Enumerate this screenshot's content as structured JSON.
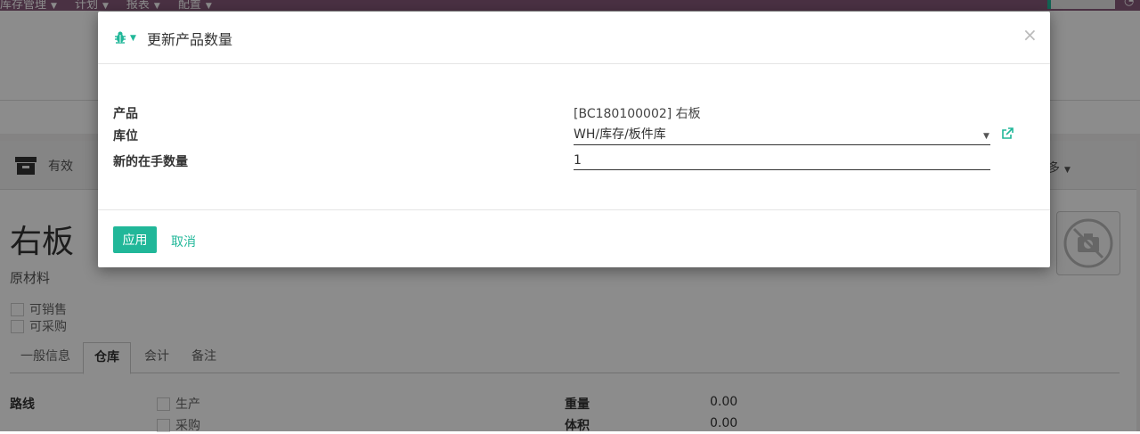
{
  "topmenu": {
    "items": [
      "库存管理",
      "计划",
      "报表",
      "配置"
    ]
  },
  "statusbar": {
    "archive_label": "有效",
    "more_label": "多"
  },
  "product": {
    "title": "右板",
    "category": "原材料",
    "can_be_sold": "可销售",
    "can_be_purchased": "可采购"
  },
  "tabs": [
    "一般信息",
    "仓库",
    "会计",
    "备注"
  ],
  "inventory": {
    "routes_label": "路线",
    "route_manufacture": "生产",
    "route_buy": "采购",
    "weight_label": "重量",
    "weight_value": "0.00",
    "volume_label": "体积",
    "volume_value": "0.00"
  },
  "modal": {
    "title": "更新产品数量",
    "close": "×",
    "product_label": "产品",
    "product_value": "[BC180100002] 右板",
    "location_label": "库位",
    "location_value": "WH/库存/板件库",
    "qty_label": "新的在手数量",
    "qty_value": "1",
    "apply_label": "应用",
    "cancel_label": "取消"
  },
  "colors": {
    "brand": "#875a7b",
    "accent": "#21b799"
  },
  "icons": [
    "bug-icon",
    "external-link-icon",
    "archive-icon",
    "no-photo-icon",
    "caret-down-icon"
  ]
}
